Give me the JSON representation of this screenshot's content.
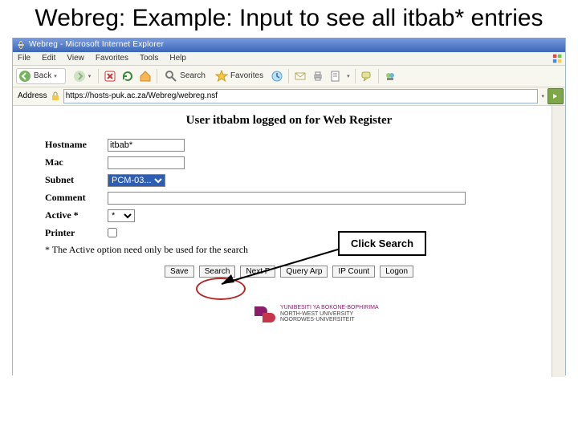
{
  "slide_title": "Webreg: Example: Input to see all itbab* entries",
  "ie": {
    "title": "Webreg - Microsoft Internet Explorer",
    "menus": {
      "file": "File",
      "edit": "Edit",
      "view": "View",
      "favorites": "Favorites",
      "tools": "Tools",
      "help": "Help"
    },
    "toolbar": {
      "back": "Back",
      "search": "Search",
      "favorites": "Favorites"
    },
    "address_label": "Address",
    "address_value": "https://hosts-puk.ac.za/Webreg/webreg.nsf"
  },
  "page": {
    "heading": "User itbabm logged on for Web Register",
    "labels": {
      "hostname": "Hostname",
      "mac": "Mac",
      "subnet": "Subnet",
      "comment": "Comment",
      "active": "Active *",
      "printer": "Printer"
    },
    "values": {
      "hostname": "itbab*",
      "mac": "",
      "subnet_option": "PCM-03...",
      "active_option": "*"
    },
    "footnote": "* The Active option need only be used for the search",
    "buttons": {
      "save": "Save",
      "search": "Search",
      "next": "Next P",
      "query": "Query Arp",
      "ipcount": "IP Count",
      "logon": "Logon"
    }
  },
  "callout": "Click Search",
  "university": {
    "line1": "YUNIBESITI YA BOKONE-BOPHIRIMA",
    "line2": "NORTH-WEST UNIVERSITY",
    "line3": "NOORDWES-UNIVERSITEIT"
  }
}
